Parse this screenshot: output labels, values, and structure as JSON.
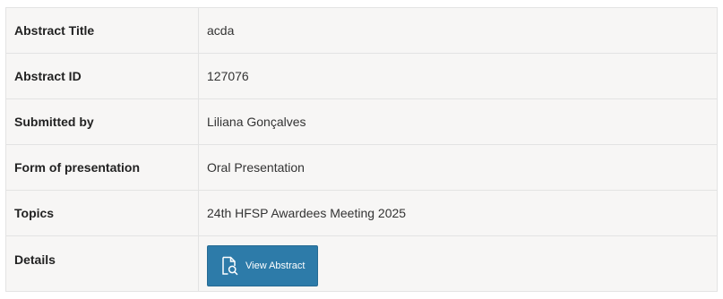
{
  "rows": [
    {
      "label": "Abstract Title",
      "value": "acda"
    },
    {
      "label": "Abstract ID",
      "value": "127076"
    },
    {
      "label": "Submitted by",
      "value": "Liliana Gonçalves"
    },
    {
      "label": "Form of presentation",
      "value": "Oral Presentation"
    },
    {
      "label": "Topics",
      "value": "24th HFSP Awardees Meeting 2025"
    },
    {
      "label": "Details"
    }
  ],
  "details_button": {
    "label": "View Abstract",
    "icon": "document-search-icon"
  },
  "colors": {
    "button_bg": "#2d7ba9",
    "row_bg": "#f7f6f5",
    "border": "#e3e3e3"
  }
}
